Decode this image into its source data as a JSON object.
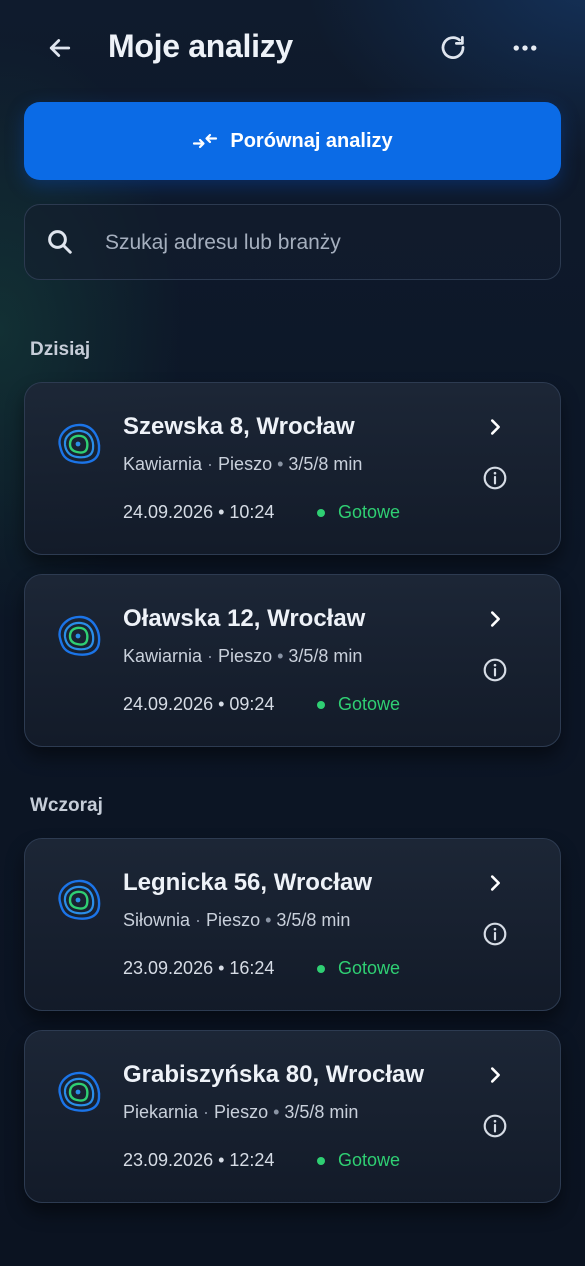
{
  "header": {
    "title": "Moje analizy",
    "back_icon": "arrow-left-icon",
    "refresh_icon": "refresh-icon",
    "more_icon": "more-horizontal-icon"
  },
  "compare_button": {
    "label": "Porównaj analizy",
    "icon": "compare-arrows-icon",
    "color": "#0b6be6"
  },
  "search": {
    "placeholder": "Szukaj adresu lub branży",
    "value": ""
  },
  "sections": [
    {
      "label": "Dzisiaj",
      "items": [
        {
          "title": "Szewska 8, Wrocław",
          "category": "Kawiarnia",
          "mode": "Pieszo",
          "times": "3/5/8 min",
          "datetime": "24.09.2026 • 10:24",
          "status": "Gotowe"
        },
        {
          "title": "Oławska 12, Wrocław",
          "category": "Kawiarnia",
          "mode": "Pieszo",
          "times": "3/5/8 min",
          "datetime": "24.09.2026 • 09:24",
          "status": "Gotowe"
        }
      ]
    },
    {
      "label": "Wczoraj",
      "items": [
        {
          "title": "Legnicka 56, Wrocław",
          "category": "Siłownia",
          "mode": "Pieszo",
          "times": "3/5/8 min",
          "datetime": "23.09.2026 • 16:24",
          "status": "Gotowe"
        },
        {
          "title": "Grabiszyńska 80, Wrocław",
          "category": "Piekarnia",
          "mode": "Pieszo",
          "times": "3/5/8 min",
          "datetime": "23.09.2026 • 12:24",
          "status": "Gotowe"
        }
      ]
    }
  ],
  "colors": {
    "accent": "#0b6be6",
    "status_ready": "#2fcf73",
    "isochrone_outer": "#1b74e8",
    "isochrone_inner": "#2fcf73"
  }
}
